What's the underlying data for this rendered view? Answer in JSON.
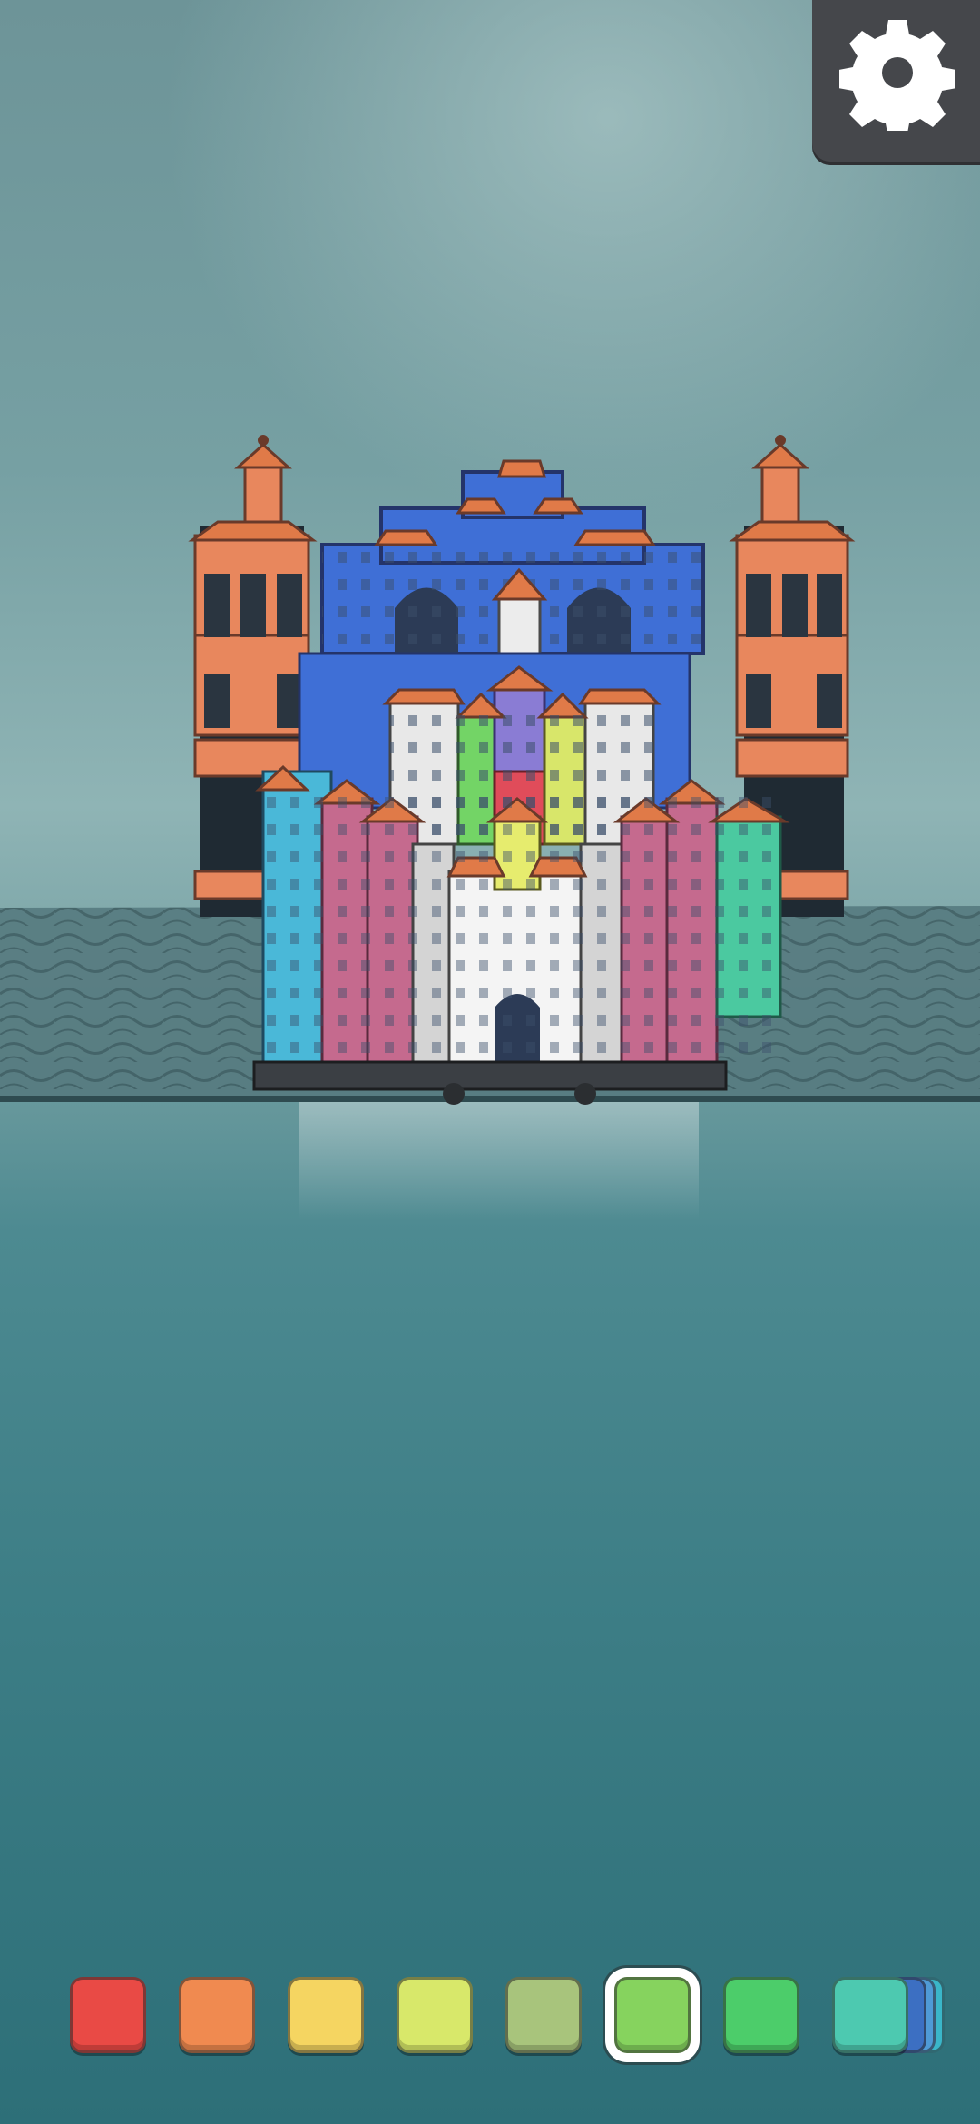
{
  "settings": {
    "icon": "gear-icon",
    "color": "#45474b"
  },
  "palette": {
    "swatches": [
      {
        "color": "#e94a45",
        "name": "red"
      },
      {
        "color": "#f08a50",
        "name": "orange"
      },
      {
        "color": "#f5d561",
        "name": "yellow"
      },
      {
        "color": "#d8e86a",
        "name": "lime"
      },
      {
        "color": "#a8c47c",
        "name": "olive"
      },
      {
        "color": "#86d35e",
        "name": "light-green"
      },
      {
        "color": "#4ccd6a",
        "name": "green"
      },
      {
        "color": "#4dc9b0",
        "name": "teal"
      }
    ],
    "selected_index": 5,
    "stack_colors": [
      "#3c6fc2",
      "#4f9ad6",
      "#3ab6c9"
    ]
  },
  "scene": {
    "sky_color": "#74a0a3",
    "water_color": "#3e7f87",
    "roof_color": "#e07a48"
  }
}
